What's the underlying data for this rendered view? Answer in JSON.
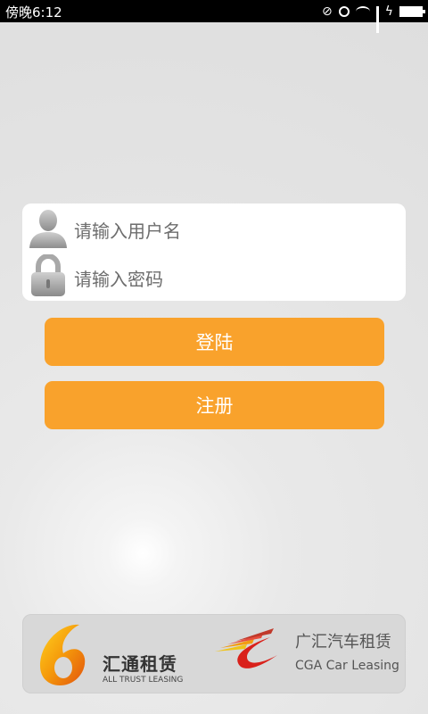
{
  "status_bar": {
    "time": "傍晚6:12"
  },
  "login_form": {
    "username_placeholder": "请输入用户名",
    "password_placeholder": "请输入密码"
  },
  "buttons": {
    "login": "登陆",
    "register": "注册"
  },
  "logos": {
    "logo1": {
      "name": "汇通租赁",
      "subtitle": "ALL TRUST LEASING"
    },
    "logo2": {
      "name": "广汇汽车租赁",
      "subtitle": "CGA Car Leasing"
    }
  },
  "colors": {
    "accent": "#f9a22c",
    "status_bar": "#000000"
  },
  "icons": [
    "mute-icon",
    "alarm-icon",
    "wifi-icon",
    "signal-icon",
    "charging-icon",
    "battery-icon",
    "user-icon",
    "lock-icon"
  ]
}
